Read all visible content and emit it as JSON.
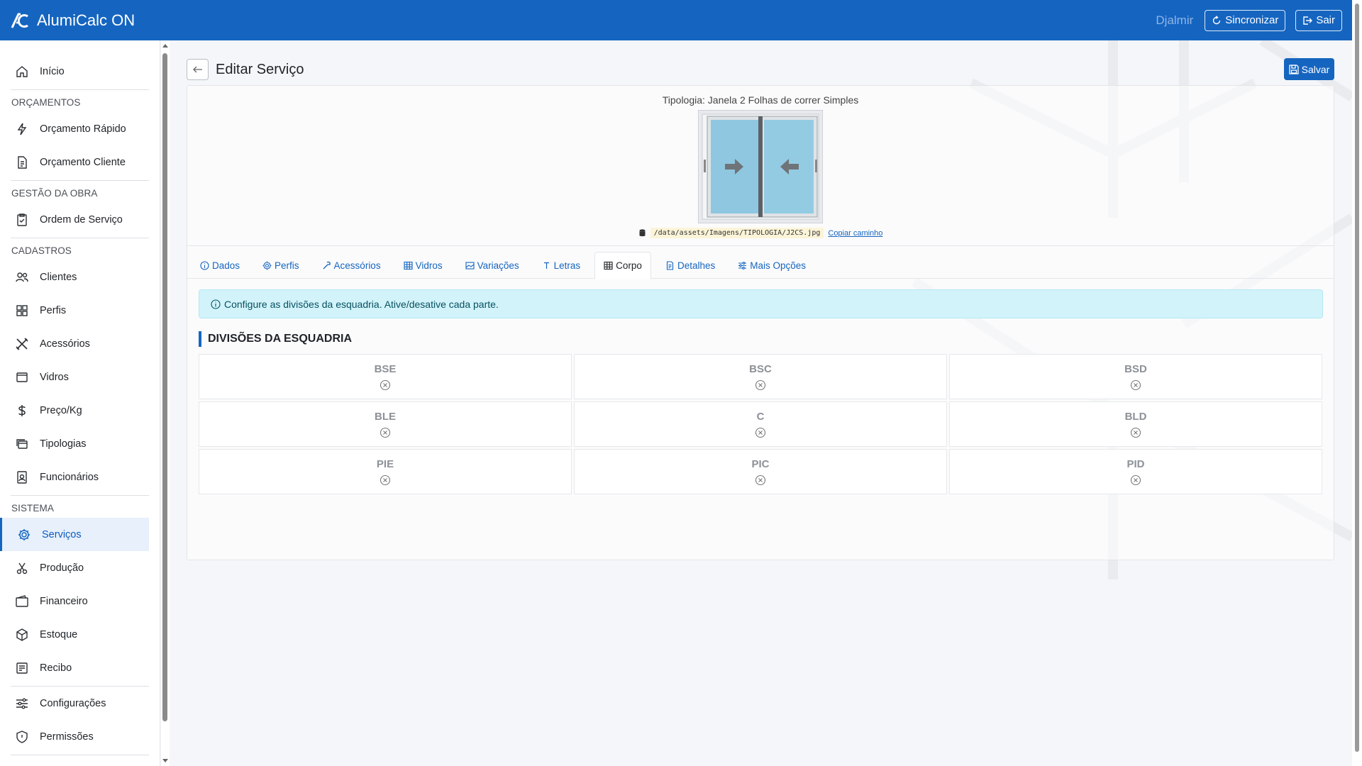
{
  "app": {
    "title": "AlumiCalc ON"
  },
  "topbar": {
    "user": "Djalmir",
    "sync_label": "Sincronizar",
    "exit_label": "Sair"
  },
  "sidebar": {
    "home": "Início",
    "sections": {
      "orcamentos": "ORÇAMENTOS",
      "gestao": "GESTÃO DA OBRA",
      "cadastros": "CADASTROS",
      "sistema": "SISTEMA"
    },
    "items": {
      "orcamento_rapido": "Orçamento Rápido",
      "orcamento_cliente": "Orçamento Cliente",
      "ordem_servico": "Ordem de Serviço",
      "clientes": "Clientes",
      "perfis": "Perfis",
      "acessorios": "Acessórios",
      "vidros": "Vidros",
      "preco_kg": "Preço/Kg",
      "tipologias": "Tipologias",
      "funcionarios": "Funcionários",
      "servicos": "Serviços",
      "producao": "Produção",
      "financeiro": "Financeiro",
      "estoque": "Estoque",
      "recibo": "Recibo",
      "configuracoes": "Configurações",
      "permissoes": "Permissões"
    }
  },
  "page": {
    "title": "Editar Serviço",
    "save_label": "Salvar"
  },
  "tipologia": {
    "title": "Tipologia: Janela 2 Folhas de correr Simples",
    "path": "/data/assets/Imagens/TIPOLOGIA/J2CS.jpg",
    "copy_label": "Copiar caminho"
  },
  "tabs": [
    "Dados",
    "Perfis",
    "Acessórios",
    "Vidros",
    "Variações",
    "Letras",
    "Corpo",
    "Detalhes",
    "Mais Opções"
  ],
  "active_tab": "Corpo",
  "info": "Configure as divisões da esquadria. Ative/desative cada parte.",
  "divisions": {
    "title": "DIVISÕES DA ESQUADRIA",
    "cells": [
      "BSE",
      "BSC",
      "BSD",
      "BLE",
      "C",
      "BLD",
      "PIE",
      "PIC",
      "PID"
    ]
  },
  "colors": {
    "primary": "#1565c0",
    "info_bg": "#d2f3fa"
  }
}
